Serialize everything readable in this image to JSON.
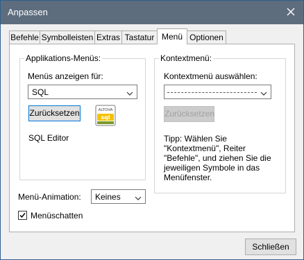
{
  "window": {
    "title": "Anpassen"
  },
  "tabs": [
    {
      "label": "Befehle"
    },
    {
      "label": "Symbolleisten"
    },
    {
      "label": "Extras"
    },
    {
      "label": "Tastatur"
    },
    {
      "label": "Menü"
    },
    {
      "label": "Optionen"
    }
  ],
  "active_tab": "Menü",
  "app_menus": {
    "group_label": "Applikations-Menüs:",
    "show_for_label": "Menüs anzeigen für:",
    "show_for_value": "SQL",
    "reset_label": "Zurücksetzen",
    "icon_text_top": "ALTOVA",
    "icon_text_main": "sql",
    "editor_name": "SQL Editor"
  },
  "context_menu": {
    "group_label": "Kontextmenü:",
    "select_label": "Kontextmenü auswählen:",
    "reset_label": "Zurücksetzen",
    "tip": "Tipp: Wählen Sie \"Kontextmenü\", Reiter \"Befehle\", und ziehen Sie die jeweiligen Symbole in das Menüfenster."
  },
  "animation": {
    "label": "Menü-Animation:",
    "value": "Keines"
  },
  "shadow": {
    "label": "Menüschatten",
    "checked": true
  },
  "footer": {
    "close_label": "Schließen"
  },
  "colors": {
    "titlebar": "#5d6d7e",
    "focus": "#0078d7",
    "icon_yellow": "#f2c200",
    "icon_green": "#7a9a2a"
  }
}
